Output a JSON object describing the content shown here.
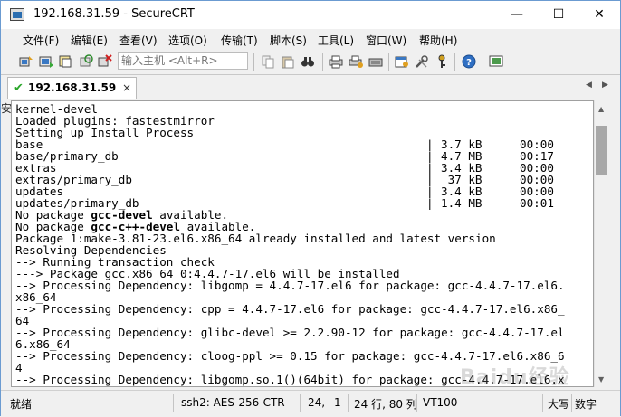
{
  "window": {
    "title": "192.168.31.59 - SecureCRT",
    "minimize_glyph": "—",
    "maximize_glyph": "☐",
    "close_glyph": "✕"
  },
  "menu": [
    {
      "label": "文件(F)"
    },
    {
      "label": "编辑(E)"
    },
    {
      "label": "查看(V)"
    },
    {
      "label": "选项(O)"
    },
    {
      "label": "传输(T)"
    },
    {
      "label": "脚本(S)"
    },
    {
      "label": "工具(L)"
    },
    {
      "label": "窗口(W)"
    },
    {
      "label": "帮助(H)"
    }
  ],
  "toolbar": {
    "connect_placeholder": "输入主机 <Alt+R>"
  },
  "tab": {
    "label": "192.168.31.59",
    "close_glyph": "×",
    "prev_glyph": "◀",
    "next_glyph": "▶"
  },
  "left_fragment": "安",
  "terminal": {
    "lines": [
      {
        "text": "kernel-devel"
      },
      {
        "text": "Loaded plugins: fastestmirror"
      },
      {
        "text": "Setting up Install Process"
      },
      {
        "text": "base",
        "bar": "|",
        "size": "3.7 kB",
        "time": "00:00"
      },
      {
        "text": "base/primary_db",
        "bar": "|",
        "size": "4.7 MB",
        "time": "00:17"
      },
      {
        "text": "extras",
        "bar": "|",
        "size": "3.4 kB",
        "time": "00:00"
      },
      {
        "text": "extras/primary_db",
        "bar": "|",
        "size": " 37 kB",
        "time": "00:00"
      },
      {
        "text": "updates",
        "bar": "|",
        "size": "3.4 kB",
        "time": "00:00"
      },
      {
        "text": "updates/primary_db",
        "bar": "|",
        "size": "1.4 MB",
        "time": "00:01"
      },
      {
        "pre": "No package ",
        "bold": "gcc-devel",
        "post": " available."
      },
      {
        "pre": "No package ",
        "bold": "gcc-c++-devel",
        "post": " available."
      },
      {
        "text": "Package 1:make-3.81-23.el6.x86_64 already installed and latest version"
      },
      {
        "text": "Resolving Dependencies"
      },
      {
        "text": "--> Running transaction check"
      },
      {
        "text": "---> Package gcc.x86_64 0:4.4.7-17.el6 will be installed"
      },
      {
        "text": "--> Processing Dependency: libgomp = 4.4.7-17.el6 for package: gcc-4.4.7-17.el6."
      },
      {
        "text": "x86_64"
      },
      {
        "text": "--> Processing Dependency: cpp = 4.4.7-17.el6 for package: gcc-4.4.7-17.el6.x86_"
      },
      {
        "text": "64"
      },
      {
        "text": "--> Processing Dependency: glibc-devel >= 2.2.90-12 for package: gcc-4.4.7-17.el"
      },
      {
        "text": "6.x86_64"
      },
      {
        "text": "--> Processing Dependency: cloog-ppl >= 0.15 for package: gcc-4.4.7-17.el6.x86_6"
      },
      {
        "text": "4"
      },
      {
        "text": "--> Processing Dependency: libgomp.so.1()(64bit) for package: gcc-4.4.7-17.el6.x"
      }
    ]
  },
  "scrollbar": {
    "up_glyph": "▲",
    "down_glyph": "▼"
  },
  "status": {
    "ready": "就绪",
    "cipher": "ssh2: AES-256-CTR",
    "row": "24,",
    "col": "1",
    "size": "24 行, 80 列",
    "term": "VT100",
    "caps": "大写",
    "num": "数字"
  },
  "watermark": "Baidu经验"
}
